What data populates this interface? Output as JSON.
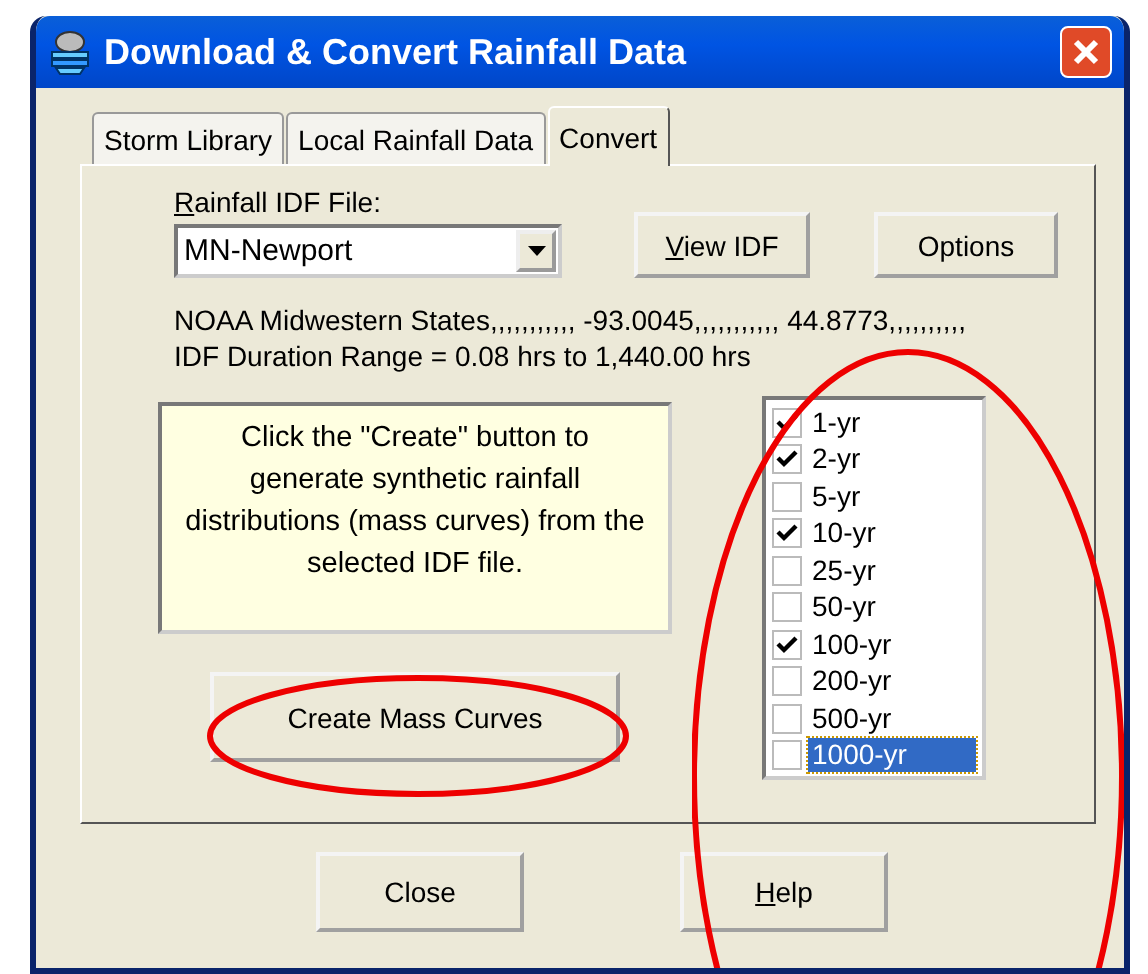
{
  "window": {
    "title": "Download & Convert Rainfall Data"
  },
  "tabs": [
    {
      "label": "Storm Library",
      "selected": false
    },
    {
      "label": "Local Rainfall Data",
      "selected": false
    },
    {
      "label": "Convert",
      "selected": true
    }
  ],
  "idf_file": {
    "label": "Rainfall IDF File:",
    "value": "MN-Newport"
  },
  "top_buttons": [
    {
      "label": "View IDF",
      "mnemonic": true
    },
    {
      "label": "Options",
      "mnemonic": false
    }
  ],
  "info_lines": [
    "NOAA Midwestern States,,,,,,,,,,, -93.0045,,,,,,,,,,, 44.8773,,,,,,,,,,",
    "IDF Duration Range =  0.08 hrs to 1,440.00 hrs"
  ],
  "hint": "Click the \"Create\" button to generate synthetic rainfall distributions (mass curves) from the selected IDF file.",
  "create_button": "Create Mass Curves",
  "return_periods": [
    {
      "label": "1-yr",
      "checked": true,
      "selected": false
    },
    {
      "label": "2-yr",
      "checked": true,
      "selected": false
    },
    {
      "label": "5-yr",
      "checked": false,
      "selected": false
    },
    {
      "label": "10-yr",
      "checked": true,
      "selected": false
    },
    {
      "label": "25-yr",
      "checked": false,
      "selected": false
    },
    {
      "label": "50-yr",
      "checked": false,
      "selected": false
    },
    {
      "label": "100-yr",
      "checked": true,
      "selected": false
    },
    {
      "label": "200-yr",
      "checked": false,
      "selected": false
    },
    {
      "label": "500-yr",
      "checked": false,
      "selected": false
    },
    {
      "label": "1000-yr",
      "checked": false,
      "selected": true
    }
  ],
  "bottom_buttons": [
    {
      "label": "Close",
      "mnemonic": false
    },
    {
      "label": "Help",
      "mnemonic": true
    }
  ]
}
